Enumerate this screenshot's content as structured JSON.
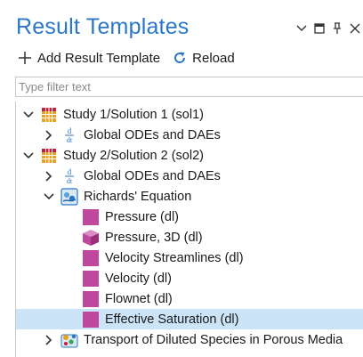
{
  "panel": {
    "title": "Result Templates",
    "controls": [
      "chevron-down-icon",
      "maximize-icon",
      "pin-icon",
      "close-icon"
    ]
  },
  "toolbar": {
    "add_label": "Add Result Template",
    "reload_label": "Reload"
  },
  "filter": {
    "placeholder": "Type filter text",
    "value": ""
  },
  "tree": {
    "study1": {
      "label": "Study 1/Solution 1 (sol1)",
      "expanded": true
    },
    "study1_global": {
      "label": "Global ODEs and DAEs",
      "expanded": false
    },
    "study2": {
      "label": "Study 2/Solution 2 (sol2)",
      "expanded": true
    },
    "study2_global": {
      "label": "Global ODEs and DAEs",
      "expanded": false
    },
    "richards": {
      "label": "Richards' Equation",
      "expanded": true
    },
    "templates": [
      {
        "label": "Pressure (dl)",
        "icon": "plot-2d-icon"
      },
      {
        "label": "Pressure, 3D (dl)",
        "icon": "plot-3d-icon"
      },
      {
        "label": "Velocity Streamlines (dl)",
        "icon": "plot-2d-icon"
      },
      {
        "label": "Velocity (dl)",
        "icon": "plot-2d-icon"
      },
      {
        "label": "Flownet (dl)",
        "icon": "plot-2d-icon"
      },
      {
        "label": "Effective Saturation (dl)",
        "icon": "plot-2d-icon",
        "selected": true
      }
    ],
    "transport": {
      "label": "Transport of Diluted Species in Porous Media",
      "expanded": false
    }
  },
  "colors": {
    "title": "#2b77c7",
    "plot_icon": "#c0479e",
    "selection": "#cce4f7"
  }
}
